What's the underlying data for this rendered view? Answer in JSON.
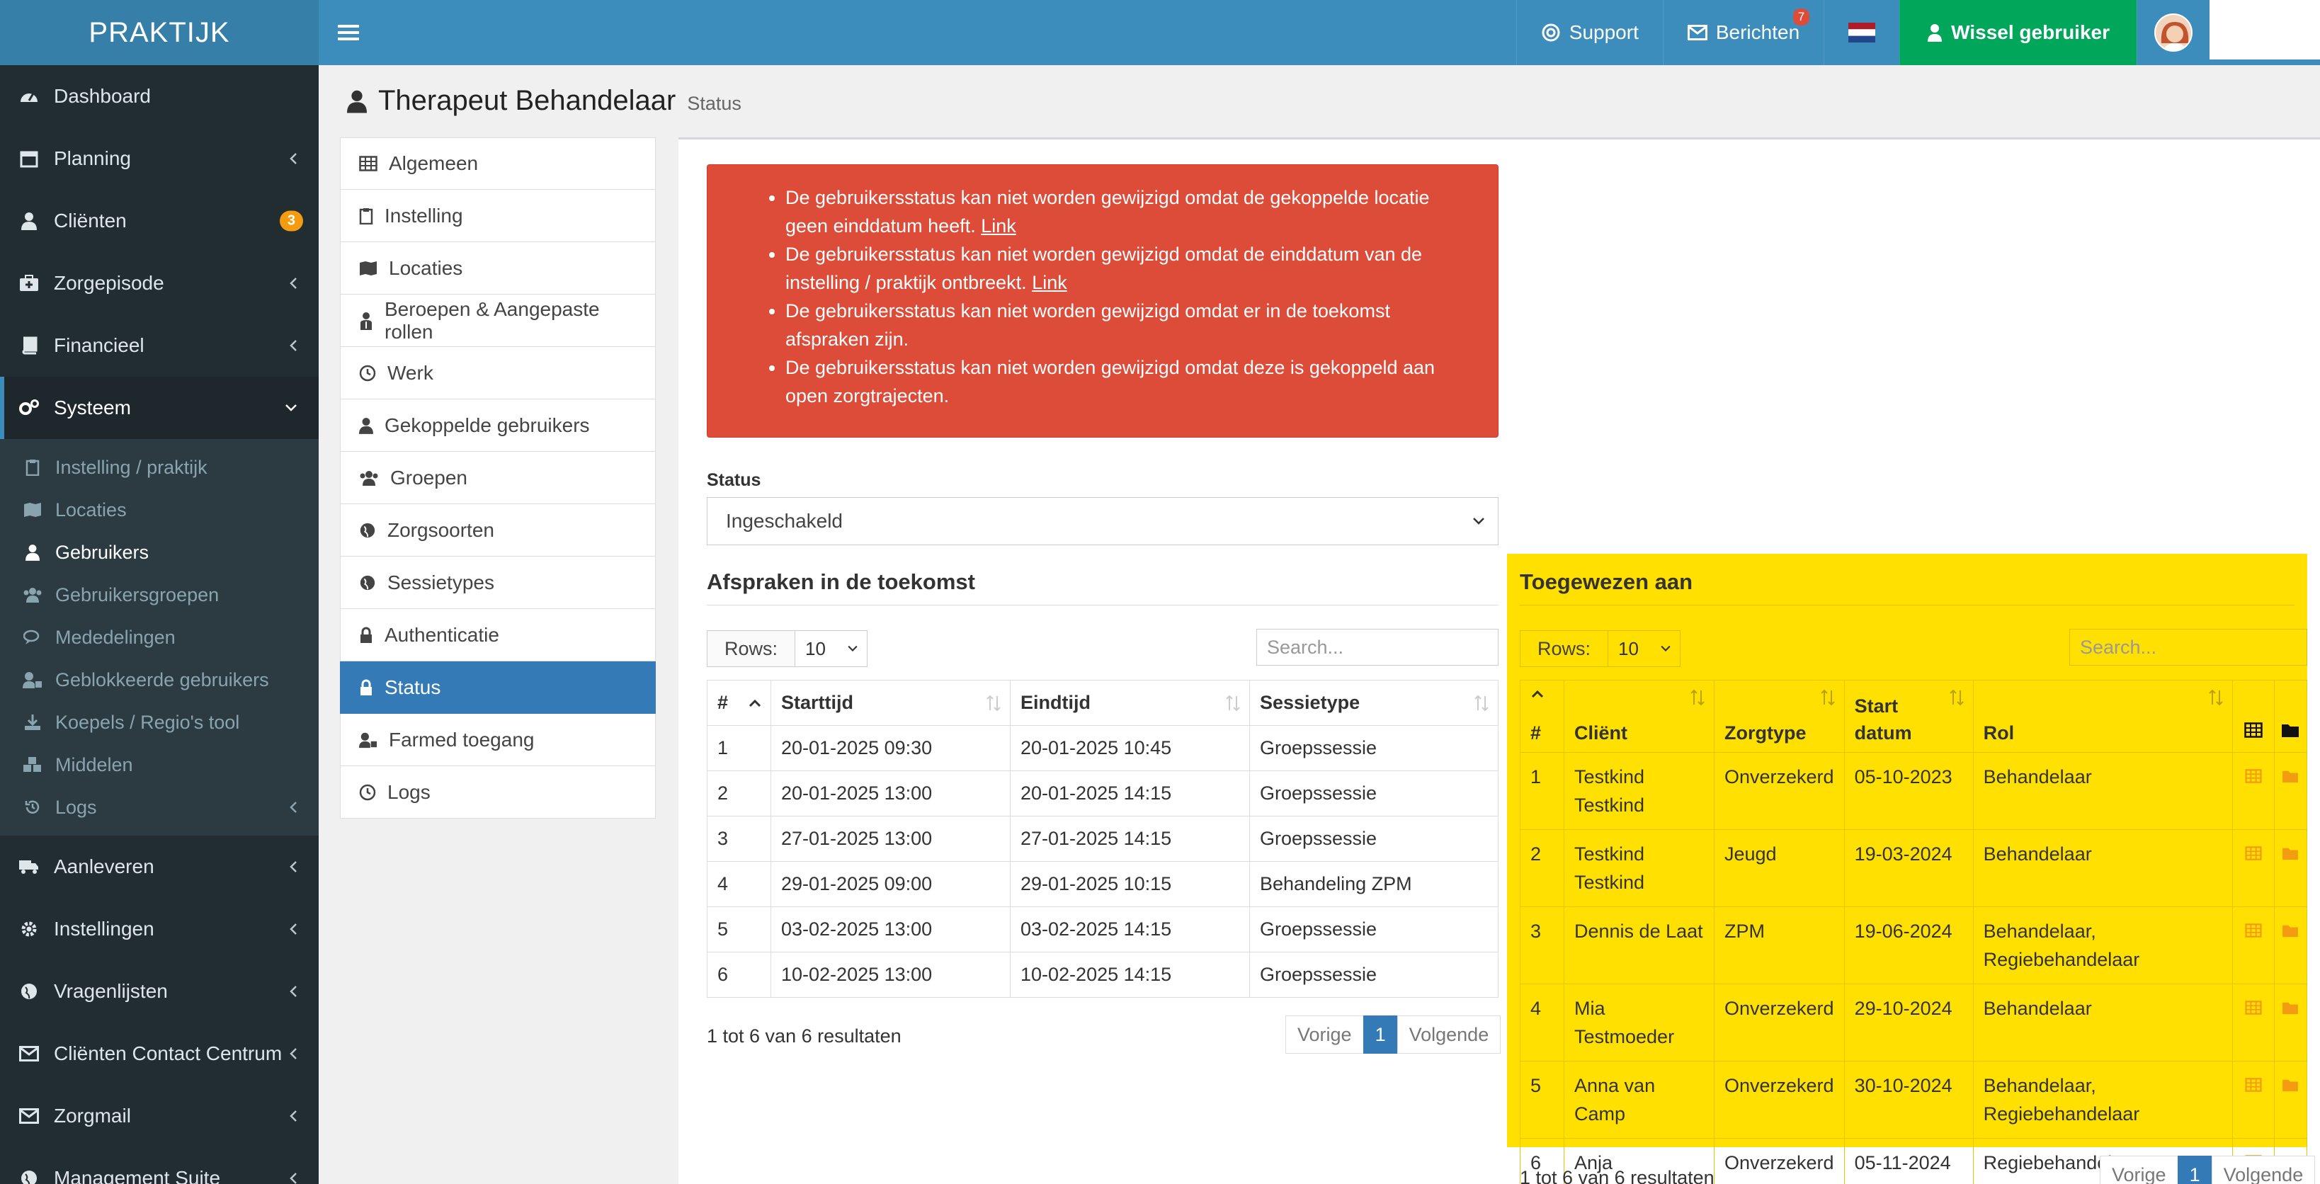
{
  "app": {
    "logo": "PRAKTIJK"
  },
  "topnav": {
    "support": "Support",
    "berichten": "Berichten",
    "berichten_count": "7",
    "switch_user": "Wissel gebruiker"
  },
  "sidebar": {
    "items": [
      {
        "label": "Dashboard"
      },
      {
        "label": "Planning"
      },
      {
        "label": "Cliënten",
        "badge": "3"
      },
      {
        "label": "Zorgepisode"
      },
      {
        "label": "Financieel"
      },
      {
        "label": "Systeem"
      }
    ],
    "sub": [
      {
        "label": "Instelling / praktijk"
      },
      {
        "label": "Locaties"
      },
      {
        "label": "Gebruikers"
      },
      {
        "label": "Gebruikersgroepen"
      },
      {
        "label": "Mededelingen"
      },
      {
        "label": "Geblokkeerde gebruikers"
      },
      {
        "label": "Koepels / Regio's tool"
      },
      {
        "label": "Middelen"
      },
      {
        "label": "Logs"
      }
    ],
    "items2": [
      {
        "label": "Aanleveren"
      },
      {
        "label": "Instellingen"
      },
      {
        "label": "Vragenlijsten"
      },
      {
        "label": "Cliënten Contact Centrum"
      },
      {
        "label": "Zorgmail"
      },
      {
        "label": "Management Suite"
      }
    ]
  },
  "page": {
    "title": "Therapeut Behandelaar",
    "subtitle": "Status"
  },
  "menu": [
    "Algemeen",
    "Instelling",
    "Locaties",
    "Beroepen & Aangepaste rollen",
    "Werk",
    "Gekoppelde gebruikers",
    "Groepen",
    "Zorgsoorten",
    "Sessietypes",
    "Authenticatie",
    "Status",
    "Farmed toegang",
    "Logs"
  ],
  "alert": {
    "msg1": "De gebruikersstatus kan niet worden gewijzigd omdat de gekoppelde locatie geen einddatum heeft.",
    "msg2": "De gebruikersstatus kan niet worden gewijzigd omdat de einddatum van de instelling / praktijk ontbreekt.",
    "msg3": "De gebruikersstatus kan niet worden gewijzigd omdat er in de toekomst afspraken zijn.",
    "msg4": "De gebruikersstatus kan niet worden gewijzigd omdat deze is gekoppeld aan open zorgtrajecten.",
    "link": "Link"
  },
  "status": {
    "label": "Status",
    "value": "Ingeschakeld"
  },
  "appointments": {
    "title": "Afspraken in de toekomst",
    "rows_label": "Rows:",
    "rows_value": "10",
    "search_placeholder": "Search...",
    "headers": [
      "#",
      "Starttijd",
      "Eindtijd",
      "Sessietype"
    ],
    "rows": [
      [
        "1",
        "20-01-2025 09:30",
        "20-01-2025 10:45",
        "Groepssessie"
      ],
      [
        "2",
        "20-01-2025 13:00",
        "20-01-2025 14:15",
        "Groepssessie"
      ],
      [
        "3",
        "27-01-2025 13:00",
        "27-01-2025 14:15",
        "Groepssessie"
      ],
      [
        "4",
        "29-01-2025 09:00",
        "29-01-2025 10:15",
        "Behandeling ZPM"
      ],
      [
        "5",
        "03-02-2025 13:00",
        "03-02-2025 14:15",
        "Groepssessie"
      ],
      [
        "6",
        "10-02-2025 13:00",
        "10-02-2025 14:15",
        "Groepssessie"
      ]
    ],
    "result": "1 tot 6 van 6 resultaten",
    "prev": "Vorige",
    "page": "1",
    "next": "Volgende"
  },
  "assigned": {
    "title": "Toegewezen aan",
    "rows_label": "Rows:",
    "rows_value": "10",
    "search_placeholder": "Search...",
    "headers": [
      "#",
      "Cliënt",
      "Zorgtype",
      "Start",
      "datum",
      "Rol"
    ],
    "rows": [
      {
        "n": "1",
        "c1": "Testkind",
        "c2": "Testkind",
        "z": "Onverzekerd",
        "d": "05-10-2023",
        "r1": "Behandelaar",
        "r2": ""
      },
      {
        "n": "2",
        "c1": "Testkind",
        "c2": "Testkind",
        "z": "Jeugd",
        "d": "19-03-2024",
        "r1": "Behandelaar",
        "r2": ""
      },
      {
        "n": "3",
        "c1": "Dennis de Laat",
        "c2": "",
        "z": "ZPM",
        "d": "19-06-2024",
        "r1": "Behandelaar,",
        "r2": "Regiebehandelaar"
      },
      {
        "n": "4",
        "c1": "Mia Testmoeder",
        "c2": "",
        "z": "Onverzekerd",
        "d": "29-10-2024",
        "r1": "Behandelaar",
        "r2": ""
      },
      {
        "n": "5",
        "c1": "Anna van Camp",
        "c2": "",
        "z": "Onverzekerd",
        "d": "30-10-2024",
        "r1": "Behandelaar,",
        "r2": "Regiebehandelaar"
      },
      {
        "n": "6",
        "c1": "Anja Andersom",
        "c2": "",
        "z": "Onverzekerd",
        "d": "05-11-2024",
        "r1": "Regiebehandelaar",
        "r2": ""
      }
    ],
    "result": "1 tot 6 van 6 resultaten",
    "prev": "Vorige",
    "page": "1",
    "next": "Volgende"
  },
  "colors": {
    "primary": "#3c8dbc",
    "sidebar": "#222d32",
    "danger": "#dd4b39",
    "success": "#00a65a",
    "highlight": "#ffe000",
    "icon_orange": "#f39c12"
  }
}
